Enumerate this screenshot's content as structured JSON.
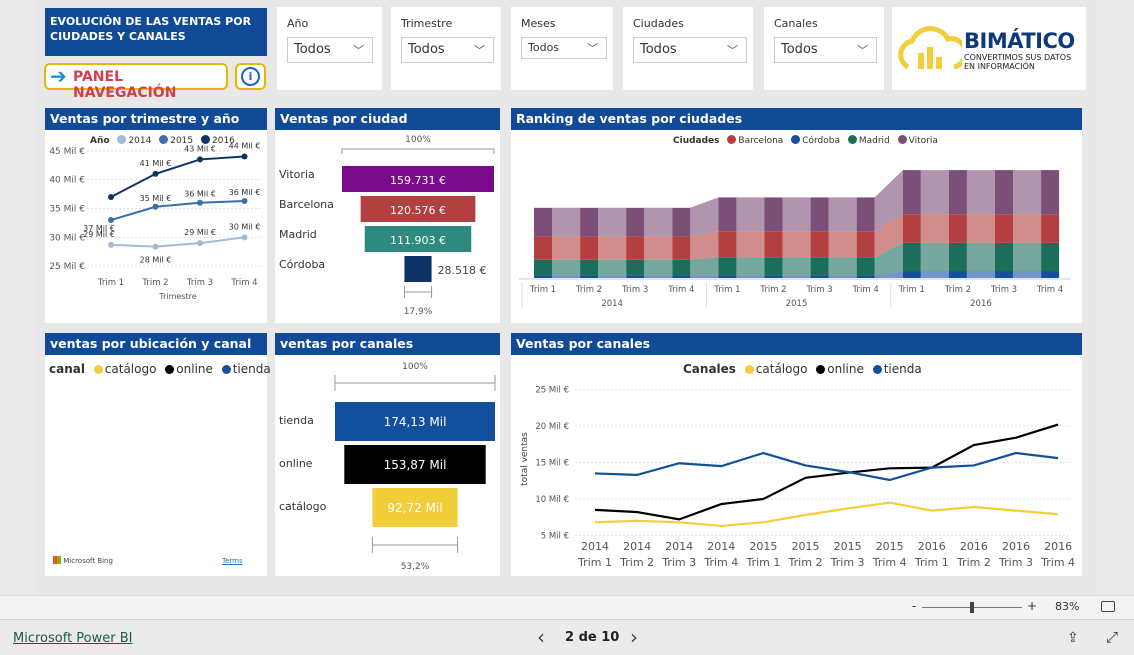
{
  "report": {
    "title": "EVOLUCIÓN DE LAS VENTAS POR CIUDADES Y CANALES",
    "nav_label": "PANEL NAVEGACIÓN",
    "info_icon": "i"
  },
  "slicers": [
    {
      "label": "Año",
      "value": "Todos"
    },
    {
      "label": "Trimestre",
      "value": "Todos"
    },
    {
      "label": "Meses",
      "value": "Todos"
    },
    {
      "label": "Ciudades",
      "value": "Todos"
    },
    {
      "label": "Canales",
      "value": "Todos"
    }
  ],
  "logo": {
    "name": "BIMÁTICO",
    "tagline1": "CONVERTIMOS SUS DATOS",
    "tagline2": "EN INFORMACIÓN"
  },
  "colors": {
    "header": "#114a96",
    "y2014": "#a2bcd6",
    "y2015": "#3c6ea8",
    "y2016": "#0f3366",
    "barcelona": "#b33f40",
    "cordoba": "#124f9c",
    "madrid": "#1c6e5b",
    "vitoria": "#7b4f77",
    "catalogo": "#f2cd3c",
    "online": "#000000",
    "tienda": "#124f9c",
    "vitoria_bar": "#7a0a8c",
    "madrid_bar": "#2e8a7e",
    "cordoba_bar": "#0f3366"
  },
  "visuals": {
    "trim": {
      "title": "Ventas por trimestre y año",
      "legend_title": "Año",
      "xlabel": "Trimestre"
    },
    "ciudad": {
      "title": "Ventas por ciudad",
      "top_pct": "100%",
      "bottom_pct": "17,9%"
    },
    "ranking": {
      "title": "Ranking de ventas por ciudades",
      "legend_title": "Ciudades"
    },
    "ubic": {
      "title": "ventas por ubicación y canal",
      "legend_title": "canal",
      "bing": "Microsoft Bing",
      "terms": "Terms"
    },
    "canales_funnel": {
      "title": "ventas por canales",
      "top_pct": "100%",
      "bottom_pct": "53,2%"
    },
    "canales_line": {
      "title": "Ventas por canales",
      "legend_title": "Canales",
      "ylabel": "total ventas"
    }
  },
  "chart_data": [
    {
      "type": "line",
      "title": "Ventas por trimestre y año",
      "xlabel": "Trimestre",
      "categories": [
        "Trim 1",
        "Trim 2",
        "Trim 3",
        "Trim 4"
      ],
      "yticks": [
        "25 Mil €",
        "30 Mil €",
        "35 Mil €",
        "40 Mil €",
        "45 Mil €"
      ],
      "ylim": [
        24,
        46
      ],
      "series": [
        {
          "name": "2014",
          "values": [
            28.7,
            28.4,
            29,
            30
          ],
          "labels": [
            "29 Mil €",
            "28 Mil €",
            "29 Mil €",
            "30 Mil €"
          ]
        },
        {
          "name": "2015",
          "values": [
            33,
            35.3,
            36,
            36.3
          ],
          "labels": [
            "37 Mil €",
            "35 Mil €",
            "36 Mil €",
            "36 Mil €"
          ]
        },
        {
          "name": "2016",
          "values": [
            37,
            41,
            43.5,
            44
          ],
          "labels": [
            "",
            "41 Mil €",
            "43 Mil €",
            "44 Mil €"
          ]
        }
      ]
    },
    {
      "type": "bar",
      "title": "Ventas por ciudad",
      "categories": [
        "Vitoria",
        "Barcelona",
        "Madrid",
        "Córdoba"
      ],
      "values": [
        159731,
        120576,
        111903,
        28518
      ],
      "labels": [
        "159.731 €",
        "120.576 €",
        "111.903 €",
        "28.518 €"
      ]
    },
    {
      "type": "area",
      "title": "Ranking de ventas por ciudades",
      "categories": [
        "Trim 1",
        "Trim 2",
        "Trim 3",
        "Trim 4",
        "Trim 1",
        "Trim 2",
        "Trim 3",
        "Trim 4",
        "Trim 1",
        "Trim 2",
        "Trim 3",
        "Trim 4"
      ],
      "groups": [
        "2014",
        "2015",
        "2016"
      ],
      "series": [
        {
          "name": "Córdoba",
          "values": [
            2,
            2,
            2,
            2,
            2,
            2,
            2,
            2,
            5,
            5,
            5,
            5
          ]
        },
        {
          "name": "Madrid",
          "values": [
            12,
            12,
            12,
            12,
            14,
            14,
            14,
            14,
            22,
            22,
            22,
            22
          ]
        },
        {
          "name": "Barcelona",
          "values": [
            18,
            18,
            18,
            18,
            20,
            20,
            20,
            20,
            22,
            22,
            22,
            22
          ]
        },
        {
          "name": "Vitoria",
          "values": [
            22,
            22,
            22,
            22,
            26,
            26,
            26,
            26,
            34,
            34,
            34,
            34
          ]
        }
      ]
    },
    {
      "type": "bar",
      "title": "ventas por canales",
      "categories": [
        "tienda",
        "online",
        "catálogo"
      ],
      "values": [
        174.13,
        153.87,
        92.72
      ],
      "labels": [
        "174,13 Mil",
        "153,87 Mil",
        "92,72 Mil"
      ]
    },
    {
      "type": "line",
      "title": "Ventas por canales",
      "ylabel": "total ventas",
      "categories": [
        "2014 Trim 1",
        "2014 Trim 2",
        "2014 Trim 3",
        "2014 Trim 4",
        "2015 Trim 1",
        "2015 Trim 2",
        "2015 Trim 3",
        "2015 Trim 4",
        "2016 Trim 1",
        "2016 Trim 2",
        "2016 Trim 3",
        "2016 Trim 4"
      ],
      "yticks": [
        "5 Mil €",
        "10 Mil €",
        "15 Mil €",
        "20 Mil €",
        "25 Mil €"
      ],
      "ylim": [
        3,
        27
      ],
      "series": [
        {
          "name": "catálogo",
          "values": [
            6.8,
            7,
            6.8,
            6.3,
            6.8,
            7.8,
            8.7,
            9.5,
            8.4,
            8.9,
            8.4,
            7.9
          ]
        },
        {
          "name": "online",
          "values": [
            8.5,
            8.2,
            7.2,
            9.3,
            10,
            12.9,
            13.6,
            14.2,
            14.3,
            17.4,
            18.4,
            20.2
          ]
        },
        {
          "name": "tienda",
          "values": [
            13.5,
            13.3,
            14.9,
            14.5,
            16.3,
            14.6,
            13.7,
            12.6,
            14.3,
            14.6,
            16.3,
            15.6
          ]
        }
      ]
    }
  ],
  "status": {
    "zoom_minus": "-",
    "zoom_plus": "+",
    "zoom": "83%",
    "zoom_level": 0.5
  },
  "footer": {
    "brand": "Microsoft Power BI",
    "page": "2 de 10",
    "prev": "‹",
    "next": "›"
  }
}
